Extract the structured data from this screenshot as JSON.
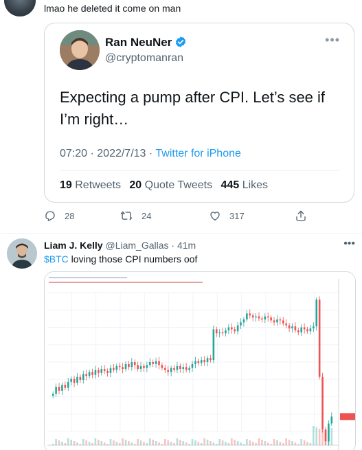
{
  "reply": {
    "text": "lmao he deleted it come on man"
  },
  "quoted_tweet": {
    "name": "Ran NeuNer",
    "handle": "@cryptomanran",
    "text": "Expecting a pump after CPI. Let’s see if I’m right…",
    "time": "07:20",
    "date": "2022/7/13",
    "source": "Twitter for iPhone",
    "retweets_count": "19",
    "retweets_label": "Retweets",
    "quotes_count": "20",
    "quotes_label": "Quote Tweets",
    "likes_count": "445",
    "likes_label": "Likes"
  },
  "actions": {
    "replies": "28",
    "retweets": "24",
    "likes": "317"
  },
  "tweet2": {
    "name": "Liam J. Kelly",
    "handle": "@Liam_Gallas",
    "time": "41m",
    "cashtag": "$BTC",
    "text": " loving those CPI numbers oof"
  },
  "chart_data": {
    "type": "candlestick",
    "ylim": [
      18800,
      20200
    ],
    "up_color": "#26a69a",
    "down_color": "#ef5350",
    "closes": [
      19180,
      19250,
      19210,
      19270,
      19240,
      19300,
      19330,
      19290,
      19350,
      19320,
      19380,
      19360,
      19400,
      19370,
      19420,
      19390,
      19430,
      19410,
      19390,
      19440,
      19420,
      19460,
      19450,
      19430,
      19480,
      19450,
      19500,
      19470,
      19430,
      19460,
      19440,
      19470,
      19500,
      19480,
      19510,
      19470,
      19440,
      19420,
      19400,
      19440,
      19420,
      19460,
      19430,
      19450,
      19420,
      19440,
      19480,
      19510,
      19490,
      19520,
      19500,
      19540,
      19520,
      19830,
      19790,
      19800,
      19790,
      19820,
      19850,
      19830,
      19810,
      19870,
      19900,
      19930,
      19990,
      19970,
      19950,
      19960,
      19940,
      19930,
      19960,
      19950,
      19920,
      19900,
      19930,
      19920,
      19890,
      19870,
      19840,
      19860,
      19820,
      19800,
      19850,
      19830,
      19810,
      19840,
      19860,
      20130,
      19350,
      18820,
      18700,
      18880,
      18950
    ]
  }
}
